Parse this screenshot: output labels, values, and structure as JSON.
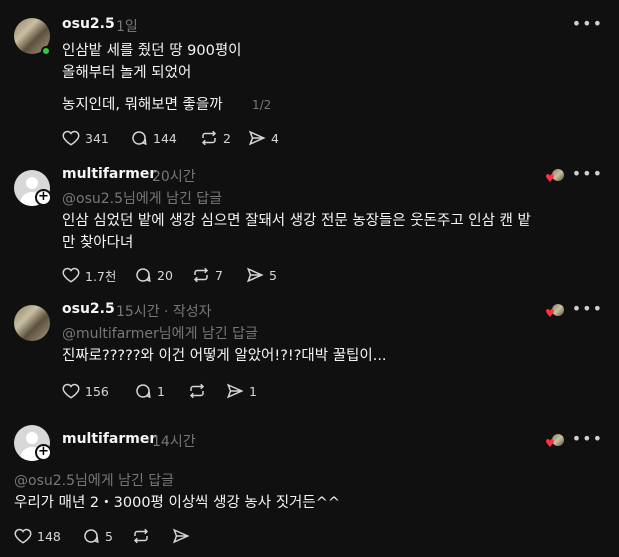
{
  "posts": [
    {
      "username": "osu2.5",
      "meta": "1일",
      "text_lines": [
        "인삼밭 세를 줬던 땅 900평이",
        "올해부터 놀게 되었어"
      ],
      "text2": "농지인데, 뭐해보면 좋을까",
      "page_indicator": "1/2",
      "likes": "341",
      "comments": "144",
      "reposts": "2",
      "shares": "4"
    },
    {
      "username": "multifarmer",
      "meta": "20시간",
      "reply_to": "@osu2.5님에게 남긴 답글",
      "text": "인삼 심었던 밭에 생강 심으면 잘돼서 생강 전문 농장들은 웃돈주고 인삼 캔 밭\n만 찾아다녀",
      "likes": "1.7천",
      "comments": "20",
      "reposts": "7",
      "shares": "5"
    },
    {
      "username": "osu2.5",
      "meta": "15시간 · 작성자",
      "reply_to": "@multifarmer님에게 남긴 답글",
      "text": "진짜로?????와 이건 어떻게 알았어!?!?대박 꿀팁이...",
      "likes": "156",
      "comments": "1",
      "reposts": "",
      "shares": "1"
    },
    {
      "username": "multifarmer",
      "meta": "14시간",
      "reply_to": "@osu2.5님에게 남긴 답글",
      "text": "우리가 매년 2・3000평 이상씩 생강 농사 짓거든^^",
      "likes": "148",
      "comments": "5",
      "reposts": "",
      "shares": ""
    }
  ],
  "icons": {
    "more": "more-horizontal-icon",
    "like": "heart-icon",
    "comment": "comment-icon",
    "repost": "repost-icon",
    "share": "share-icon"
  },
  "colors": {
    "background": "#101010",
    "text": "#f3f5f7",
    "muted": "#777777",
    "online": "#2ecc40",
    "heart": "#ff3040"
  }
}
